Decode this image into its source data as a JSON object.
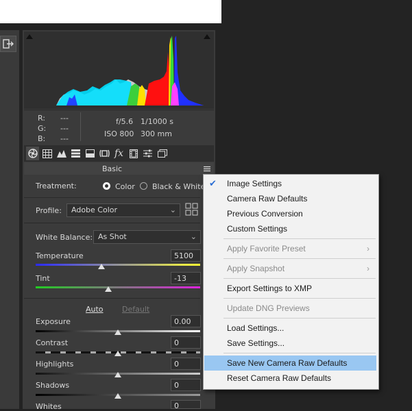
{
  "info": {
    "r_label": "R:",
    "g_label": "G:",
    "b_label": "B:",
    "r_val": "---",
    "g_val": "---",
    "b_val": "---",
    "aperture": "f/5.6",
    "shutter": "1/1000 s",
    "iso": "ISO 800",
    "focal": "300 mm"
  },
  "section": {
    "title": "Basic"
  },
  "treatment": {
    "label": "Treatment:",
    "opt_color": "Color",
    "opt_bw": "Black & White",
    "selected": "Color"
  },
  "profile": {
    "label": "Profile:",
    "value": "Adobe Color"
  },
  "white_balance": {
    "label": "White Balance:",
    "value": "As Shot"
  },
  "sliders": {
    "temperature": {
      "label": "Temperature",
      "value": "5100",
      "level": 0.4
    },
    "tint": {
      "label": "Tint",
      "value": "-13",
      "level": 0.44
    },
    "auto": "Auto",
    "default": "Default",
    "exposure": {
      "label": "Exposure",
      "value": "0.00",
      "level": 0.5
    },
    "contrast": {
      "label": "Contrast",
      "value": "0",
      "level": 0.5
    },
    "highlights": {
      "label": "Highlights",
      "value": "0",
      "level": 0.5
    },
    "shadows": {
      "label": "Shadows",
      "value": "0",
      "level": 0.5
    },
    "whites": {
      "label": "Whites",
      "value": "0"
    }
  },
  "menu": {
    "image_settings": "Image Settings",
    "camera_raw_defaults": "Camera Raw Defaults",
    "previous_conversion": "Previous Conversion",
    "custom_settings": "Custom Settings",
    "apply_favorite_preset": "Apply Favorite Preset",
    "apply_snapshot": "Apply Snapshot",
    "export_settings_xmp": "Export Settings to XMP",
    "update_dng_previews": "Update DNG Previews",
    "load_settings": "Load Settings...",
    "save_settings": "Save Settings...",
    "save_new_defaults": "Save New Camera Raw Defaults",
    "reset_defaults": "Reset Camera Raw Defaults"
  },
  "colors": {
    "menu_highlight": "#99c7f2",
    "check": "#2b6ed4"
  }
}
